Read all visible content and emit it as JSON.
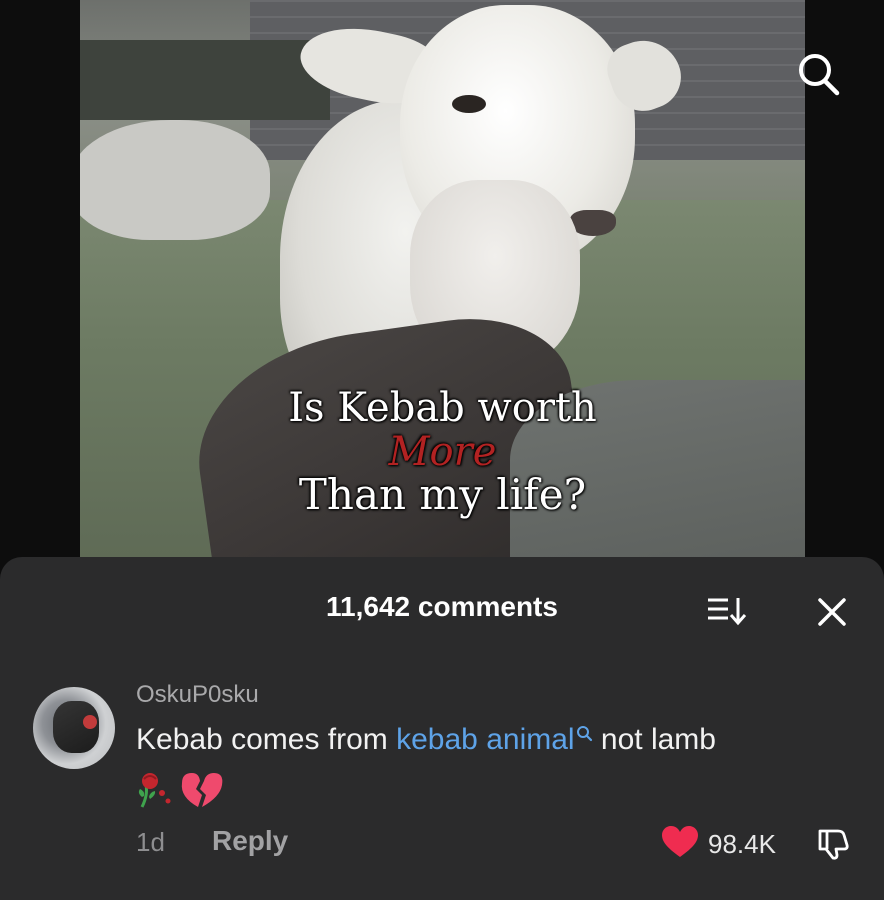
{
  "video": {
    "caption_line1": "Is Kebab worth",
    "caption_line2": "More",
    "caption_line3": "Than my life?",
    "search_icon": "search-icon"
  },
  "comments_panel": {
    "count_label": "11,642 comments",
    "sort_icon": "sort-icon",
    "close_icon": "close-icon",
    "comment": {
      "username": "OskuP0sku",
      "text_before": "Kebab comes from ",
      "link_text": "kebab animal",
      "text_after": " not lamb",
      "emojis": "rose-and-broken-heart",
      "timestamp": "1d",
      "reply_label": "Reply",
      "like_count": "98.4K"
    }
  },
  "colors": {
    "sheet_bg": "#2b2b2c",
    "link": "#5ea3e8",
    "heart": "#ef2c50",
    "caption_accent": "#b22222"
  }
}
